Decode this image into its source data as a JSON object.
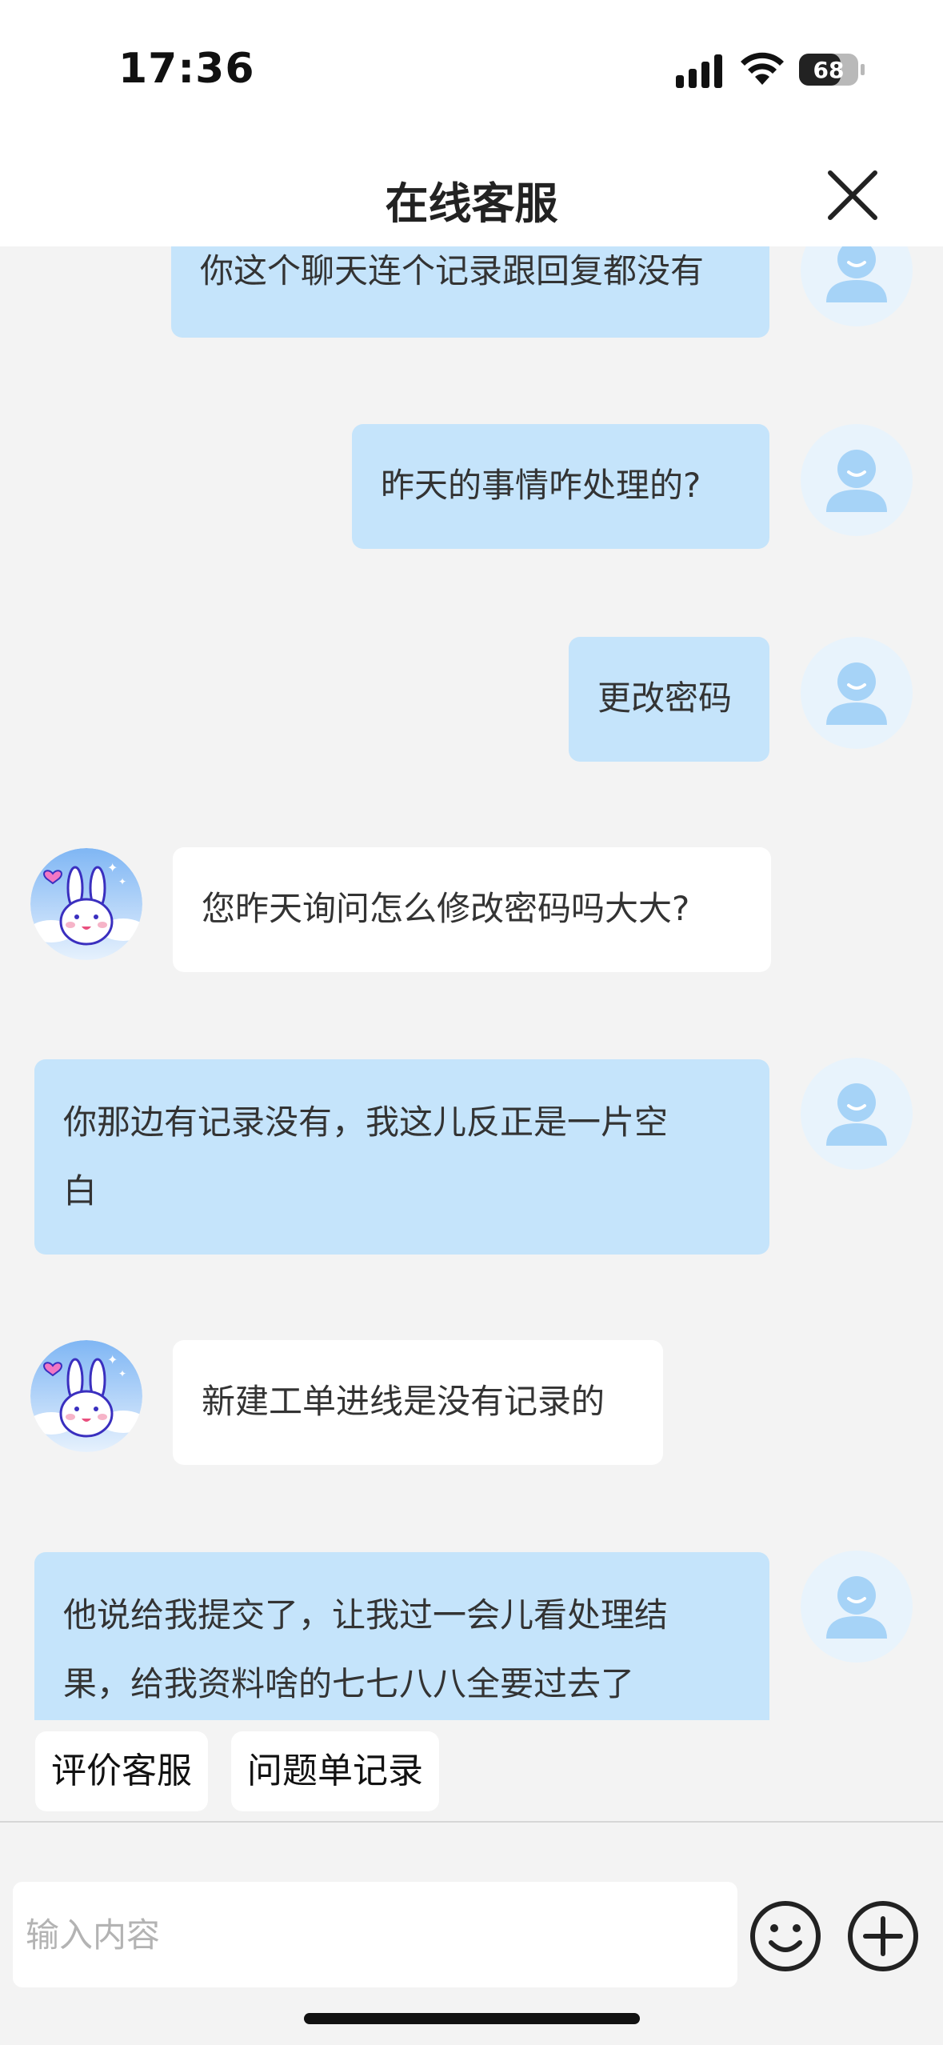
{
  "status_bar": {
    "time": "17:36",
    "battery": "68"
  },
  "header": {
    "title": "在线客服"
  },
  "messages": [
    {
      "sender": "user",
      "lines": [
        "你这个聊天连个记录跟回复都没有"
      ]
    },
    {
      "sender": "user",
      "lines": [
        "昨天的事情咋处理的?"
      ]
    },
    {
      "sender": "user",
      "lines": [
        "更改密码"
      ]
    },
    {
      "sender": "agent",
      "lines": [
        "您昨天询问怎么修改密码吗大大?"
      ]
    },
    {
      "sender": "user",
      "lines": [
        "你那边有记录没有，我这儿反正是一片空",
        "白"
      ]
    },
    {
      "sender": "agent",
      "lines": [
        "新建工单进线是没有记录的"
      ]
    },
    {
      "sender": "user",
      "lines": [
        "他说给我提交了，让我过一会儿看处理结",
        "果，给我资料啥的七七八八全要过去了"
      ]
    }
  ],
  "quick_actions": {
    "rate_label": "评价客服",
    "tickets_label": "问题单记录"
  },
  "input": {
    "placeholder": "输入内容"
  },
  "colors": {
    "user_bubble": "#c5e4fb",
    "agent_bubble": "#ffffff",
    "background": "#f3f3f3"
  }
}
